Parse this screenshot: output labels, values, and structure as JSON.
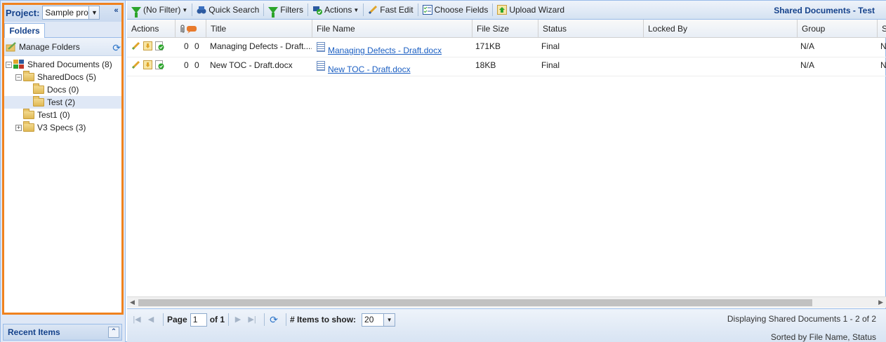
{
  "left": {
    "project_label": "Project:",
    "project_value": "Sample pro",
    "tab_label": "Folders",
    "manage_folders": "Manage Folders",
    "tree": [
      {
        "label": "Shared Documents (8)",
        "level": 0,
        "toggle": "minus",
        "root": true
      },
      {
        "label": "SharedDocs (5)",
        "level": 1,
        "toggle": "minus"
      },
      {
        "label": "Docs (0)",
        "level": 2,
        "toggle": ""
      },
      {
        "label": "Test (2)",
        "level": 2,
        "toggle": "",
        "selected": true
      },
      {
        "label": "Test1 (0)",
        "level": 1,
        "toggle": ""
      },
      {
        "label": "V3 Specs (3)",
        "level": 1,
        "toggle": "plus"
      }
    ],
    "recent_items": "Recent Items",
    "highlight_color": "#f0821e"
  },
  "toolbar": {
    "filter": "(No Filter)",
    "quick_search": "Quick Search",
    "filters": "Filters",
    "actions": "Actions",
    "fast_edit": "Fast Edit",
    "choose_fields": "Choose Fields",
    "upload_wizard": "Upload Wizard",
    "title": "Shared Documents - Test"
  },
  "grid": {
    "columns": {
      "actions": "Actions",
      "title": "Title",
      "file_name": "File Name",
      "file_size": "File Size",
      "status": "Status",
      "locked_by": "Locked By",
      "group": "Group",
      "extra": "S"
    },
    "rows": [
      {
        "att": "0",
        "com": "0",
        "title": "Managing Defects - Draft....",
        "file_name": "Managing Defects - Draft.docx",
        "file_size": "171KB",
        "status": "Final",
        "locked_by": "",
        "group": "N/A",
        "extra": "N"
      },
      {
        "att": "0",
        "com": "0",
        "title": "New TOC - Draft.docx",
        "file_name": "New TOC - Draft.docx",
        "file_size": "18KB",
        "status": "Final",
        "locked_by": "",
        "group": "N/A",
        "extra": "N"
      }
    ]
  },
  "pager": {
    "page_label": "Page",
    "page_value": "1",
    "of_label": "of 1",
    "items_label": "# Items to show:",
    "items_value": "20",
    "display_text": "Displaying Shared Documents 1 - 2 of 2",
    "sorted_text": "Sorted by File Name, Status"
  }
}
